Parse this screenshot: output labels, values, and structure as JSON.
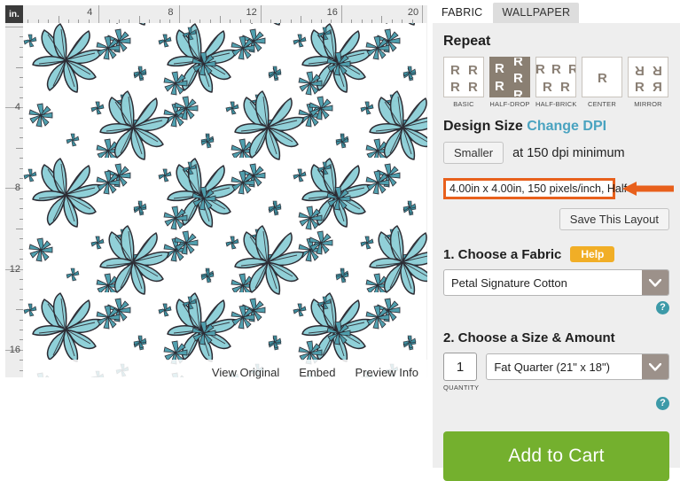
{
  "preview": {
    "ruler_unit_label": "in.",
    "h_ticks": [
      4,
      8,
      12,
      16,
      20
    ],
    "v_ticks": [
      4,
      8,
      12,
      16
    ],
    "links": [
      {
        "label": "View Original",
        "name": "view-original-link"
      },
      {
        "label": "Embed",
        "name": "embed-link"
      },
      {
        "label": "Preview Info",
        "name": "preview-info-link"
      }
    ],
    "pattern": {
      "description": "teal floral repeat",
      "flower_fill": "#8fd0d8",
      "outline": "#2b2b33",
      "background": "#ffffff"
    }
  },
  "tabs": [
    {
      "label": "FABRIC",
      "active": true
    },
    {
      "label": "WALLPAPER",
      "active": false
    }
  ],
  "repeat": {
    "title": "Repeat",
    "options": [
      {
        "label": "BASIC",
        "selected": false
      },
      {
        "label": "HALF-DROP",
        "selected": true
      },
      {
        "label": "HALF-BRICK",
        "selected": false
      },
      {
        "label": "CENTER",
        "selected": false
      },
      {
        "label": "MIRROR",
        "selected": false
      }
    ],
    "swatch_glyph": "R"
  },
  "design_size": {
    "title": "Design Size",
    "change_dpi_label": "Change DPI",
    "smaller_button": "Smaller",
    "dpi_note": "at 150 dpi minimum",
    "size_value": "4.00in x 4.00in, 150 pixels/inch, Half",
    "save_layout_button": "Save This Layout",
    "highlight_color": "#e8601c",
    "link_color": "#4aa3c0"
  },
  "fabric_step": {
    "title": "1. Choose a Fabric",
    "help_label": "Help",
    "help_color": "#f1ae26",
    "selected_fabric": "Petal Signature Cotton",
    "help_icon": "question-circle-icon"
  },
  "size_step": {
    "title": "2. Choose a Size & Amount",
    "quantity_value": "1",
    "quantity_label": "QUANTITY",
    "selected_size": "Fat Quarter (21\" x 18\")",
    "help_icon": "question-circle-icon"
  },
  "cart": {
    "button_label": "Add to Cart",
    "button_color": "#74b02e"
  }
}
